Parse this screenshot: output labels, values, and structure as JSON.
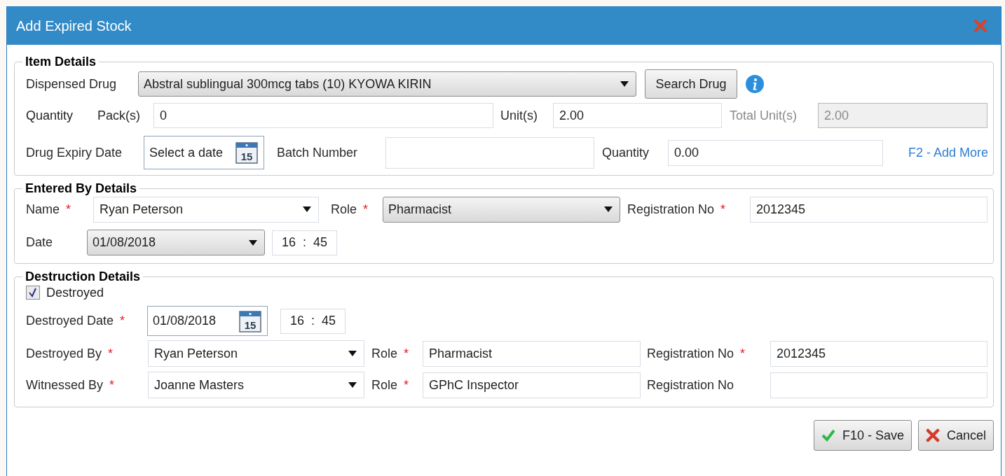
{
  "window": {
    "title": "Add Expired Stock"
  },
  "item_details": {
    "legend": "Item Details",
    "dispensed_drug": {
      "label": "Dispensed Drug",
      "field": {
        "kind": "select",
        "value": "Abstral sublingual 300mcg tabs (10) KYOWA KIRIN"
      }
    },
    "search_button": "Search Drug",
    "quantity_label": "Quantity",
    "packs": {
      "label": "Pack(s)",
      "field": {
        "kind": "text",
        "value": "0"
      }
    },
    "units": {
      "label": "Unit(s)",
      "field": {
        "kind": "text",
        "value": "2.00"
      }
    },
    "total_units": {
      "label": "Total Unit(s)",
      "disabled": true,
      "field": {
        "kind": "text",
        "value": "2.00"
      }
    },
    "expiry_date": {
      "label": "Drug Expiry Date",
      "field": {
        "kind": "date",
        "placeholder": "Select a date",
        "icon_text": "15"
      }
    },
    "batch_number": {
      "label": "Batch Number",
      "field": {
        "kind": "text"
      }
    },
    "quantity": {
      "label": "Quantity",
      "field": {
        "kind": "text",
        "value": "0.00"
      }
    },
    "add_more_link": "F2 - Add More"
  },
  "entered_by": {
    "legend": "Entered By Details",
    "name": {
      "label": "Name",
      "required_mark": "*",
      "field": {
        "kind": "combo",
        "value": "Ryan Peterson"
      }
    },
    "role": {
      "label": "Role",
      "required_mark": "*",
      "field": {
        "kind": "select",
        "value": "Pharmacist"
      }
    },
    "registration_no": {
      "label": "Registration No",
      "required_mark": "*",
      "field": {
        "kind": "text",
        "value": "2012345"
      }
    },
    "date": {
      "label": "Date",
      "field": {
        "kind": "select",
        "value": "01/08/2018"
      }
    },
    "time": {
      "kind": "time",
      "hours": "16",
      "separator": ":",
      "minutes": "45"
    }
  },
  "destruction": {
    "legend": "Destruction Details",
    "destroyed": {
      "label": "Destroyed",
      "checked": true
    },
    "destroyed_date": {
      "label": "Destroyed Date",
      "required_mark": "*",
      "field": {
        "kind": "date",
        "value": "01/08/2018",
        "icon_text": "15"
      }
    },
    "time": {
      "kind": "time",
      "hours": "16",
      "separator": ":",
      "minutes": "45"
    },
    "destroyed_by": {
      "label": "Destroyed By",
      "required_mark": "*",
      "field": {
        "kind": "combo",
        "value": "Ryan Peterson"
      }
    },
    "destroyed_by_role": {
      "label": "Role",
      "required_mark": "*",
      "field": {
        "kind": "text",
        "value": "Pharmacist"
      }
    },
    "destroyed_by_registration_no": {
      "label": "Registration No",
      "required_mark": "*",
      "field": {
        "kind": "text",
        "value": "2012345"
      }
    },
    "witnessed_by": {
      "label": "Witnessed By",
      "required_mark": "*",
      "field": {
        "kind": "combo",
        "value": "Joanne Masters"
      }
    },
    "witnessed_by_role": {
      "label": "Role",
      "required_mark": "*",
      "field": {
        "kind": "text",
        "value": "GPhC Inspector"
      }
    },
    "witnessed_by_registration_no": {
      "label": "Registration No",
      "field": {
        "kind": "text"
      }
    }
  },
  "buttons": [
    {
      "kind": "save",
      "label": "F10 - Save"
    },
    {
      "kind": "cancel",
      "label": "Cancel"
    }
  ]
}
